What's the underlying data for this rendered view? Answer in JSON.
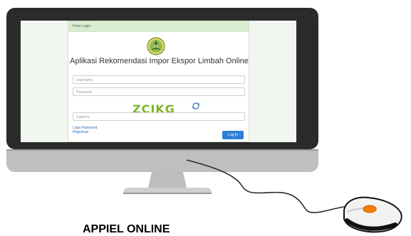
{
  "login": {
    "panel_title": "Form Login",
    "app_title": "Aplikasi Rekomendasi Impor Ekspor Limbah Online",
    "username_placeholder": "Username",
    "password_placeholder": "Password",
    "captcha_code": "ZCIKG",
    "captcha_placeholder": "Captcha",
    "forgot_password": "Lupa Password",
    "register": "Registrasi",
    "login_button": "Log In"
  },
  "caption": {
    "text": "APPIEL ONLINE"
  },
  "colors": {
    "header_green": "#d9ecd0",
    "captcha_green": "#7db428",
    "button_blue": "#2f7fd7",
    "link_blue": "#2f6fb5"
  },
  "icons": {
    "logo": "ministry-seal-icon",
    "refresh": "refresh-icon"
  }
}
